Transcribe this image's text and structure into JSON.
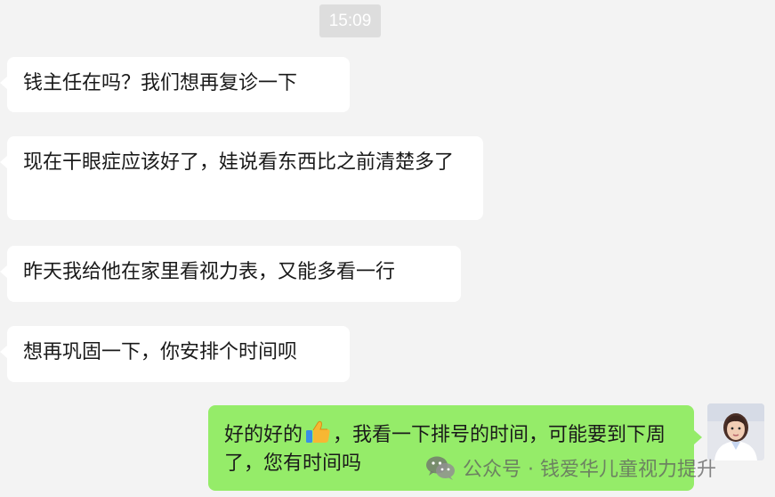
{
  "chat": {
    "timestamp": "15:09",
    "messages": [
      {
        "side": "left",
        "text": "钱主任在吗？我们想再复诊一下"
      },
      {
        "side": "left",
        "text": "现在干眼症应该好了，娃说看东西比之前清楚多了"
      },
      {
        "side": "left",
        "text": "昨天我给他在家里看视力表，又能多看一行"
      },
      {
        "side": "left",
        "text": "想再巩固一下，你安排个时间呗"
      },
      {
        "side": "right",
        "text_before_emoji": "好的好的",
        "emoji": "thumbs-up-icon",
        "text_after_emoji": "，我看一下排号的时间，可能要到下周了，您有时间吗"
      }
    ],
    "avatar": "doctor-avatar"
  },
  "watermark": {
    "icon": "wechat-icon",
    "text": "公众号 · 钱爱华儿童视力提升"
  },
  "colors": {
    "background": "#f3f3f3",
    "incoming_bubble": "#ffffff",
    "outgoing_bubble": "#95ec69",
    "timestamp_bg": "#dddddd",
    "text": "#1a1a1a"
  }
}
